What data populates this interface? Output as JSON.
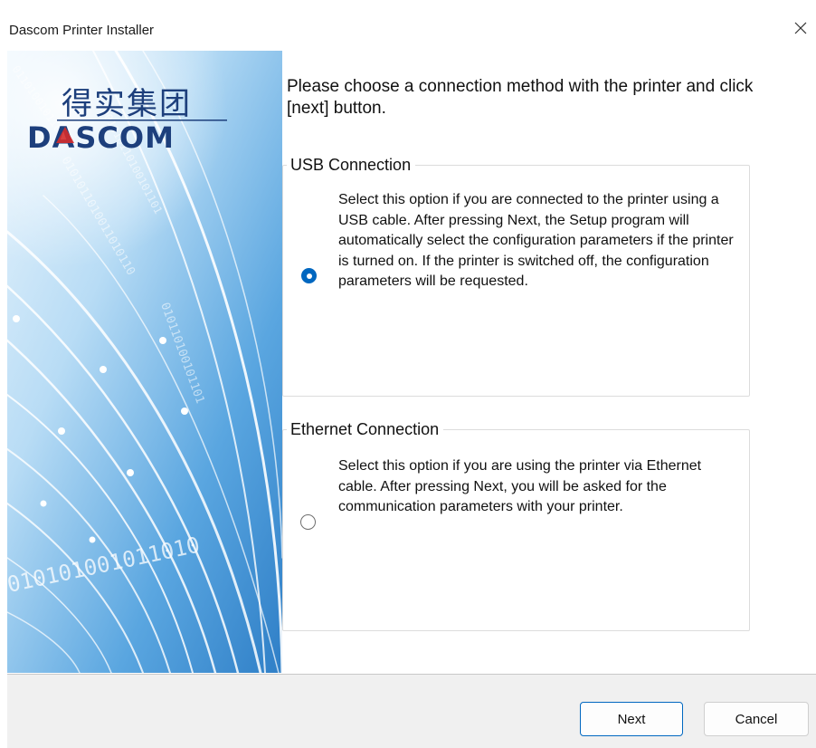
{
  "window": {
    "title": "Dascom Printer Installer"
  },
  "banner": {
    "logo_chinese": "得实集团",
    "logo_text": "DASCOM",
    "binary_text": "010101001011010",
    "colors": {
      "brand_blue": "#1d3f7c",
      "brand_red": "#d52b2b",
      "sky": "#cfe7f8",
      "deep": "#3a8fd0"
    }
  },
  "instruction": "Please choose a connection method with the printer and click [next] button.",
  "options": [
    {
      "legend": "USB Connection",
      "selected": true,
      "description": "Select this option if you are connected to the printer using a USB cable. After pressing Next, the Setup program will automatically select the configuration parameters if the printer is turned on. If the printer is switched off, the configuration parameters will be requested."
    },
    {
      "legend": "Ethernet Connection",
      "selected": false,
      "description": "Select this option if you are using the printer via Ethernet cable. After pressing Next, you will be asked for the communication parameters with your printer."
    }
  ],
  "buttons": {
    "next": "Next",
    "cancel": "Cancel"
  },
  "accent_color": "#0067c0"
}
